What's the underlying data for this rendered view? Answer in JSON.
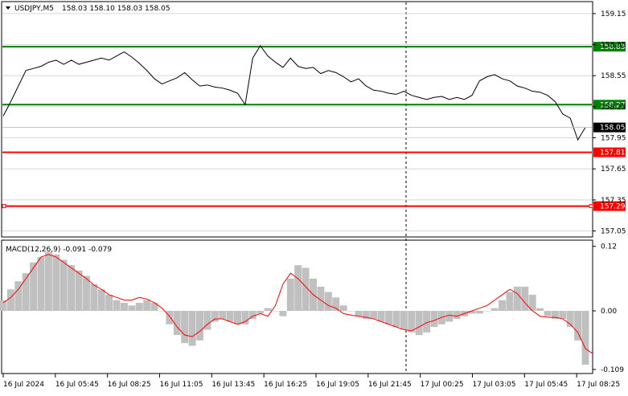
{
  "header": {
    "symbol": "USDJPY,M5",
    "ohlc": "158.03 158.10 158.03 158.05"
  },
  "macd": {
    "label": "MACD(12,26,9) -0.091 -0.079"
  },
  "colors": {
    "price_line": "#000000",
    "resistance": "#008000",
    "support": "#ff0000",
    "histogram": "#c0c0c0",
    "signal": "#ff0000",
    "grid": "#d8d8d8"
  },
  "chart_data": [
    {
      "type": "line",
      "title": "USDJPY,M5",
      "ylim": [
        157.0,
        159.25
      ],
      "y_ticks": [
        "159.15",
        "158.85",
        "158.55",
        "158.25",
        "157.95",
        "157.65",
        "157.35",
        "157.05"
      ],
      "x_ticks": [
        "16 Jul 2024",
        "16 Jul 05:45",
        "16 Jul 08:25",
        "16 Jul 11:05",
        "16 Jul 13:45",
        "16 Jul 16:25",
        "16 Jul 19:05",
        "16 Jul 21:45",
        "17 Jul 00:25",
        "17 Jul 03:05",
        "17 Jul 05:45",
        "17 Jul 08:25"
      ],
      "price": [
        158.16,
        158.3,
        158.45,
        158.6,
        158.62,
        158.64,
        158.68,
        158.7,
        158.66,
        158.7,
        158.66,
        158.68,
        158.7,
        158.72,
        158.7,
        158.74,
        158.78,
        158.73,
        158.67,
        158.6,
        158.52,
        158.47,
        158.5,
        158.53,
        158.58,
        158.51,
        158.45,
        158.46,
        158.44,
        158.43,
        158.41,
        158.38,
        158.27,
        158.72,
        158.84,
        158.74,
        158.68,
        158.63,
        158.72,
        158.64,
        158.62,
        158.63,
        158.57,
        158.6,
        158.58,
        158.54,
        158.49,
        158.52,
        158.45,
        158.41,
        158.4,
        158.38,
        158.37,
        158.4,
        158.36,
        158.34,
        158.32,
        158.34,
        158.35,
        158.32,
        158.34,
        158.32,
        158.36,
        158.5,
        158.54,
        158.56,
        158.52,
        158.5,
        158.45,
        158.43,
        158.4,
        158.39,
        158.36,
        158.3,
        158.18,
        158.14,
        157.93,
        158.05
      ],
      "current_price": "158.05",
      "levels": [
        {
          "value": 158.83,
          "label": "158.83",
          "color": "#008000"
        },
        {
          "value": 158.27,
          "label": "158.27",
          "color": "#008000"
        },
        {
          "value": 157.81,
          "label": "157.81",
          "color": "#ff0000"
        },
        {
          "value": 157.29,
          "label": "157.29",
          "color": "#ff0000"
        }
      ]
    },
    {
      "type": "bar",
      "title": "MACD(12,26,9) -0.091 -0.079",
      "ylim": [
        -0.115,
        0.13
      ],
      "y_ticks": [
        "0.12",
        "0.00",
        "-0.109"
      ],
      "histogram": [
        0.02,
        0.04,
        0.055,
        0.07,
        0.09,
        0.1,
        0.11,
        0.105,
        0.095,
        0.085,
        0.075,
        0.065,
        0.05,
        0.04,
        0.03,
        0.02,
        0.015,
        0.01,
        0.015,
        0.02,
        0.015,
        0.0,
        -0.025,
        -0.045,
        -0.06,
        -0.065,
        -0.055,
        -0.035,
        -0.02,
        -0.015,
        -0.02,
        -0.025,
        -0.025,
        -0.015,
        -0.005,
        0.005,
        0.0,
        -0.01,
        0.06,
        0.085,
        0.08,
        0.06,
        0.045,
        0.035,
        0.025,
        0.01,
        0.0,
        -0.01,
        -0.015,
        -0.015,
        -0.02,
        -0.025,
        -0.03,
        -0.035,
        -0.04,
        -0.045,
        -0.04,
        -0.03,
        -0.025,
        -0.02,
        -0.015,
        -0.01,
        -0.005,
        -0.005,
        0.0,
        0.005,
        0.02,
        0.035,
        0.045,
        0.045,
        0.03,
        0.005,
        -0.01,
        -0.015,
        -0.015,
        -0.03,
        -0.055,
        -0.1
      ],
      "signal": [
        0.015,
        0.025,
        0.04,
        0.06,
        0.08,
        0.1,
        0.105,
        0.1,
        0.09,
        0.08,
        0.07,
        0.06,
        0.048,
        0.04,
        0.03,
        0.025,
        0.02,
        0.02,
        0.025,
        0.022,
        0.015,
        0.005,
        -0.01,
        -0.03,
        -0.045,
        -0.048,
        -0.038,
        -0.025,
        -0.015,
        -0.015,
        -0.02,
        -0.025,
        -0.02,
        -0.01,
        -0.005,
        -0.01,
        0.01,
        0.05,
        0.07,
        0.06,
        0.045,
        0.03,
        0.02,
        0.01,
        0.005,
        -0.005,
        -0.008,
        -0.01,
        -0.012,
        -0.015,
        -0.02,
        -0.025,
        -0.03,
        -0.035,
        -0.037,
        -0.03,
        -0.022,
        -0.018,
        -0.012,
        -0.008,
        -0.01,
        -0.005,
        0.0,
        0.005,
        0.01,
        0.02,
        0.03,
        0.04,
        0.032,
        0.015,
        0.0,
        -0.01,
        -0.012,
        -0.012,
        -0.015,
        -0.025,
        -0.04,
        -0.07,
        -0.08
      ]
    }
  ]
}
